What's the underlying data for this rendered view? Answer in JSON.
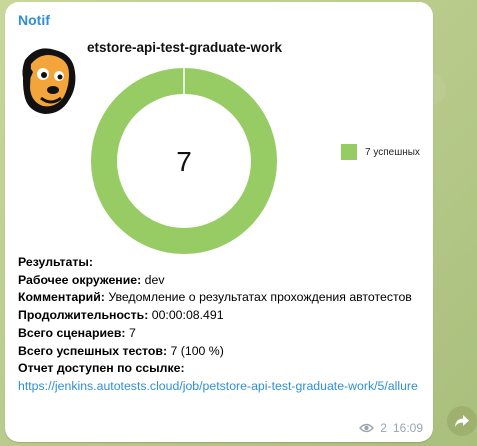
{
  "message": {
    "sender": "Notif",
    "chart_title": "etstore-api-test-graduate-work",
    "results_label": "Результаты:",
    "env_label": "Рабочее окружение:",
    "env_value": "dev",
    "comment_label": "Комментарий:",
    "comment_value": "Уведомление о результатах прохождения автотестов",
    "duration_label": "Продолжительность:",
    "duration_value": "00:00:08.491",
    "scenarios_label": "Всего сценариев:",
    "scenarios_value": "7",
    "passed_label": "Всего успешных тестов:",
    "passed_value": "7 (100 %)",
    "report_label": "Отчет доступен по ссылке:",
    "report_link": "https://jenkins.autotests.cloud/job/petstore-api-test-graduate-work/5/allure",
    "views": "2",
    "time": "16:09"
  },
  "chart_data": {
    "type": "pie",
    "title": "etstore-api-test-graduate-work",
    "center_label": "7",
    "series": [
      {
        "name": "7 успешных",
        "value": 7,
        "color": "#97cc64"
      }
    ],
    "legend": "right"
  },
  "icons": {
    "views": "eye-icon",
    "share": "share-arrow-icon",
    "logo": "allure-dog-logo"
  }
}
